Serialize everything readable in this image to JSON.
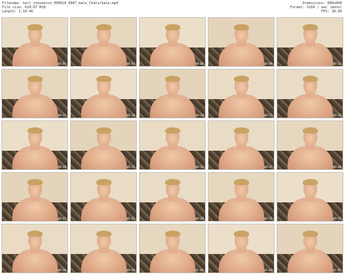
{
  "header": {
    "filename": "Filename: karl_steveevsh_090818_0987_male_Chaturbate.mp4",
    "filesize": "File size: 618.07 MiB",
    "length": "Length: 1:10:46",
    "dimensions": "Dimensions: 800x600",
    "format": "Format: h264 / aac (mono)",
    "fps": "FPS: 30.00"
  },
  "thumbnails": [
    {
      "time": "00:01"
    },
    {
      "time": "00:03"
    },
    {
      "time": "00:06"
    },
    {
      "time": "00:09"
    },
    {
      "time": "00:12"
    },
    {
      "time": "00:15"
    },
    {
      "time": "00:18"
    },
    {
      "time": "00:20"
    },
    {
      "time": "00:23"
    },
    {
      "time": "00:26"
    },
    {
      "time": "00:28"
    },
    {
      "time": "00:31"
    },
    {
      "time": "00:34"
    },
    {
      "time": "00:37"
    },
    {
      "time": "00:40"
    },
    {
      "time": "00:42"
    },
    {
      "time": "00:45"
    },
    {
      "time": "00:48"
    },
    {
      "time": "00:51"
    },
    {
      "time": "00:53"
    },
    {
      "time": "00:56"
    },
    {
      "time": "00:59"
    },
    {
      "time": "01:01"
    },
    {
      "time": "01:04"
    },
    {
      "time": "01:07"
    }
  ]
}
